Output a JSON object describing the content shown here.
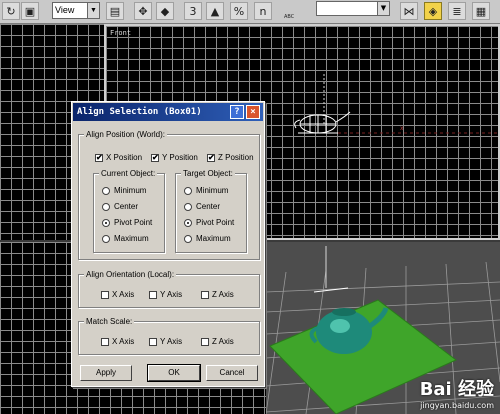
{
  "toolbar": {
    "view_select": "View",
    "icons": [
      "undo-arrow-icon",
      "select-box-icon",
      "color-swatch-icon",
      "move-pivot-icon",
      "manipulate-cube-icon",
      "angle-snap-icon",
      "percent-snap-icon",
      "spinner-snap-icon",
      "named-selection-icon",
      "mirror-icon",
      "align-icon",
      "layers-icon",
      "curve-editor-icon"
    ],
    "snap_labels": {
      "angle": "3",
      "percent": "%",
      "spinner": "n"
    },
    "abc_label": "ABC"
  },
  "viewports": {
    "front_label": "Front"
  },
  "dialog": {
    "title": "Align Selection (Box01)",
    "help_label": "?",
    "close_label": "×",
    "align_position": {
      "legend": "Align Position (World):",
      "checks": [
        {
          "label": "X Position",
          "checked": true
        },
        {
          "label": "Y Position",
          "checked": true
        },
        {
          "label": "Z Position",
          "checked": true
        }
      ]
    },
    "current_object": {
      "legend": "Current Object:",
      "options": [
        "Minimum",
        "Center",
        "Pivot Point",
        "Maximum"
      ],
      "selected": "Pivot Point"
    },
    "target_object": {
      "legend": "Target Object:",
      "options": [
        "Minimum",
        "Center",
        "Pivot Point",
        "Maximum"
      ],
      "selected": "Pivot Point"
    },
    "align_orientation": {
      "legend": "Align Orientation (Local):",
      "checks": [
        {
          "label": "X Axis",
          "checked": false
        },
        {
          "label": "Y Axis",
          "checked": false
        },
        {
          "label": "Z Axis",
          "checked": false
        }
      ]
    },
    "match_scale": {
      "legend": "Match Scale:",
      "checks": [
        {
          "label": "X Axis",
          "checked": false
        },
        {
          "label": "Y Axis",
          "checked": false
        },
        {
          "label": "Z Axis",
          "checked": false
        }
      ]
    },
    "buttons": {
      "apply": "Apply",
      "ok": "OK",
      "cancel": "Cancel"
    },
    "check_mark": "✔"
  },
  "watermark": {
    "brand": "Bai 经验",
    "url": "jingyan.baidu.com"
  },
  "colors": {
    "title_bar": "#0a246a",
    "plane_green": "#3fa52a",
    "teapot_teal": "#1e8a7a",
    "active_tool": "#f2d24a"
  }
}
